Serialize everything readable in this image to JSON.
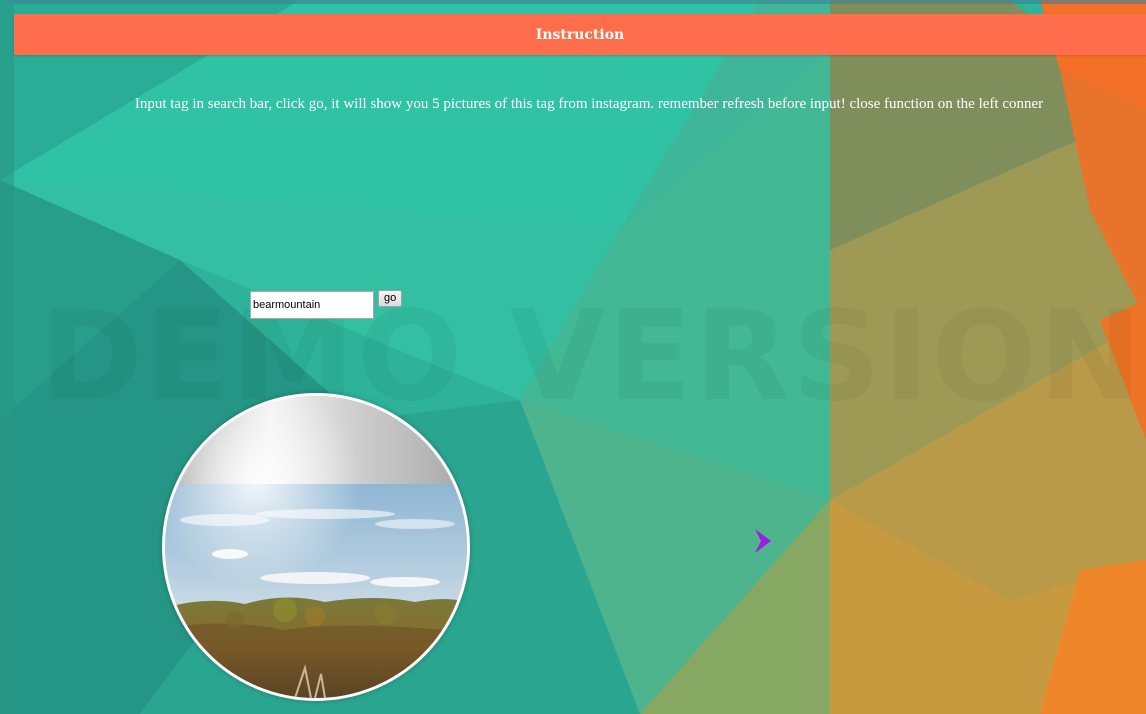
{
  "header": {
    "title": "Instruction"
  },
  "instruction": {
    "text": "Input tag in search bar, click go, it will show you 5 pictures of this tag from instagram. remember refresh before input! close function on the left conner"
  },
  "watermark": {
    "text": "DEMO VERSION"
  },
  "search": {
    "value": "bearmountain",
    "go_label": "go"
  },
  "gallery": {
    "next_icon": "chevron-right-icon"
  },
  "colors": {
    "header": "#ff6e4c",
    "teal": "#2fc4a4",
    "orange": "#f47c2a",
    "arrow": "#9b1fe0"
  }
}
